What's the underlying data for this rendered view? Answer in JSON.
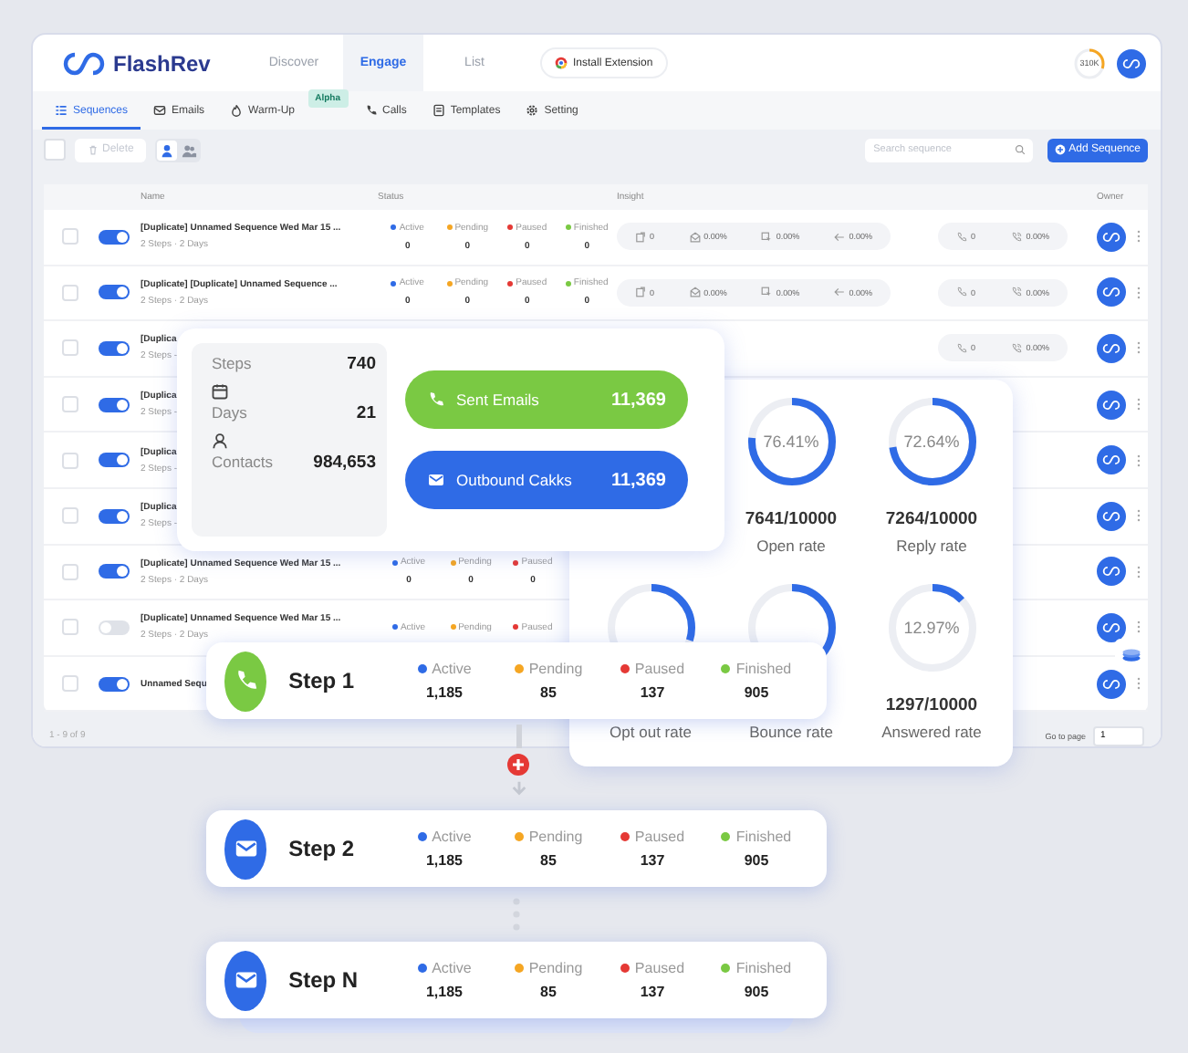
{
  "header": {
    "logo": "FlashRev",
    "tabs": [
      {
        "label": "Discover",
        "selected": false
      },
      {
        "label": "Engage",
        "selected": true
      },
      {
        "label": "List",
        "selected": false
      }
    ],
    "extension_button": "Install Extension",
    "credits": "310K"
  },
  "subnav": [
    {
      "label": "Sequences",
      "kind": "list",
      "selected": true
    },
    {
      "label": "Emails",
      "kind": "mail",
      "selected": false
    },
    {
      "label": "Warm-Up",
      "kind": "flame",
      "selected": false,
      "badge": "Alpha"
    },
    {
      "label": "Calls",
      "kind": "phone",
      "selected": false
    },
    {
      "label": "Templates",
      "kind": "template",
      "selected": false
    },
    {
      "label": "Setting",
      "kind": "gear",
      "selected": false
    }
  ],
  "toolbar": {
    "select_all_checked": false,
    "delete_button": "Delete",
    "delete_disabled": true,
    "view_toggle": [
      {
        "kind": "single",
        "selected": true
      },
      {
        "kind": "group",
        "selected": false
      }
    ],
    "search": {
      "placeholder": "Search sequence"
    },
    "add_button": "Add Sequence"
  },
  "table": {
    "columns": [
      "Name",
      "Status",
      "Insight",
      "Owner"
    ],
    "rows": [
      {
        "checked": false,
        "toggle_on": true,
        "name": "[Duplicate] Unnamed Sequence Wed Mar 15 ...",
        "meta": "2 Steps · 2 Days",
        "statuses": [
          {
            "label": "Active",
            "count": "0",
            "color": "#2f6be6"
          },
          {
            "label": "Pending",
            "count": "0",
            "color": "#f5a623"
          },
          {
            "label": "Paused",
            "count": "0",
            "color": "#e53935"
          },
          {
            "label": "Finished",
            "count": "0",
            "color": "#7ac943"
          }
        ],
        "email_insight": [
          {
            "kind": "sent",
            "value": "0"
          },
          {
            "kind": "open",
            "value": "0.00%"
          },
          {
            "kind": "click",
            "value": "0.00%"
          },
          {
            "kind": "reply",
            "value": "0.00%"
          }
        ],
        "call_insight": [
          {
            "kind": "call",
            "value": "0"
          },
          {
            "kind": "connect",
            "value": "0.00%"
          }
        ]
      },
      {
        "checked": false,
        "toggle_on": true,
        "name": "[Duplicate] [Duplicate] Unnamed Sequence ...",
        "meta": "2 Steps · 2 Days",
        "statuses": [
          {
            "label": "Active",
            "count": "0",
            "color": "#2f6be6"
          },
          {
            "label": "Pending",
            "count": "0",
            "color": "#f5a623"
          },
          {
            "label": "Paused",
            "count": "0",
            "color": "#e53935"
          },
          {
            "label": "Finished",
            "count": "0",
            "color": "#7ac943"
          }
        ],
        "email_insight": [
          {
            "kind": "sent",
            "value": "0"
          },
          {
            "kind": "open",
            "value": "0.00%"
          },
          {
            "kind": "click",
            "value": "0.00%"
          },
          {
            "kind": "reply",
            "value": "0.00%"
          }
        ],
        "call_insight": [
          {
            "kind": "call",
            "value": "0"
          },
          {
            "kind": "connect",
            "value": "0.00%"
          }
        ]
      },
      {
        "checked": false,
        "toggle_on": true,
        "name": "[Duplica",
        "meta": "2 Steps -",
        "statuses": [],
        "email_insight": [],
        "call_insight": [
          {
            "kind": "call",
            "value": "0"
          },
          {
            "kind": "connect",
            "value": "0.00%"
          }
        ]
      },
      {
        "checked": false,
        "toggle_on": true,
        "name": "[Duplica",
        "meta": "2 Steps -",
        "statuses": [],
        "email_insight": [],
        "call_insight": []
      },
      {
        "checked": false,
        "toggle_on": true,
        "name": "[Duplica",
        "meta": "2 Steps -",
        "statuses": [],
        "email_insight": [],
        "call_insight": []
      },
      {
        "checked": false,
        "toggle_on": true,
        "name": "[Duplica",
        "meta": "2 Steps -",
        "statuses": [],
        "email_insight": [],
        "call_insight": []
      },
      {
        "checked": false,
        "toggle_on": true,
        "name": "[Duplicate] Unnamed Sequence Wed Mar 15 ...",
        "meta": "2 Steps · 2 Days",
        "statuses": [
          {
            "label": "Active",
            "count": "0",
            "color": "#2f6be6"
          },
          {
            "label": "Pending",
            "count": "0",
            "color": "#f5a623"
          },
          {
            "label": "Paused",
            "count": "0",
            "color": "#e53935"
          }
        ],
        "email_insight": [],
        "call_insight": []
      },
      {
        "checked": false,
        "toggle_on": false,
        "name": "[Duplicate] Unnamed Sequence Wed Mar 15 ...",
        "meta": "2 Steps · 2 Days",
        "statuses": [
          {
            "label": "Active",
            "color": "#2f6be6"
          },
          {
            "label": "Pending",
            "color": "#f5a623"
          },
          {
            "label": "Paused",
            "color": "#e53935"
          }
        ],
        "email_insight": [],
        "call_insight": []
      },
      {
        "checked": false,
        "toggle_on": true,
        "name": "Unnamed Sequ",
        "statuses": [],
        "email_insight": [],
        "call_insight": []
      }
    ]
  },
  "pagination": {
    "summary": "1 - 9 of 9",
    "goto_label": "Go to page",
    "page": "1"
  },
  "stats_card": {
    "items": [
      {
        "kind": "steps",
        "label": "Steps",
        "value": "740"
      },
      {
        "kind": "days",
        "label": "Days",
        "value": "21"
      },
      {
        "kind": "contacts",
        "label": "Contacts",
        "value": "984,653"
      }
    ],
    "pills": [
      {
        "kind": "phone",
        "label": "Sent Emails",
        "value": "11,369",
        "color": "#7ac943"
      },
      {
        "kind": "mail",
        "label": "Outbound Cakks",
        "value": "11,369",
        "color": "#2f6be6"
      }
    ]
  },
  "rates": [
    {
      "percent": "76.41%",
      "fraction": "7641/10000",
      "label": "Open rate",
      "level": 0.7641
    },
    {
      "percent": "72.64%",
      "fraction": "7264/10000",
      "label": "Reply rate",
      "level": 0.7264
    },
    {
      "label": "Opt out rate",
      "level": 0.3
    },
    {
      "label": "Bounce rate",
      "level": 0.4
    },
    {
      "percent": "12.97%",
      "fraction": "1297/10000",
      "label": "Answered rate",
      "level": 0.1297
    }
  ],
  "steps": [
    {
      "kind": "call",
      "title": "Step 1",
      "stats": [
        {
          "label": "Active",
          "value": "1,185",
          "color": "#2f6be6"
        },
        {
          "label": "Pending",
          "value": "85",
          "color": "#f5a623"
        },
        {
          "label": "Paused",
          "value": "137",
          "color": "#e53935"
        },
        {
          "label": "Finished",
          "value": "905",
          "color": "#7ac943"
        }
      ]
    },
    {
      "kind": "email",
      "title": "Step 2",
      "stats": [
        {
          "label": "Active",
          "value": "1,185",
          "color": "#2f6be6"
        },
        {
          "label": "Pending",
          "value": "85",
          "color": "#f5a623"
        },
        {
          "label": "Paused",
          "value": "137",
          "color": "#e53935"
        },
        {
          "label": "Finished",
          "value": "905",
          "color": "#7ac943"
        }
      ]
    },
    {
      "kind": "email",
      "title": "Step N",
      "stats": [
        {
          "label": "Active",
          "value": "1,185",
          "color": "#2f6be6"
        },
        {
          "label": "Pending",
          "value": "85",
          "color": "#f5a623"
        },
        {
          "label": "Paused",
          "value": "137",
          "color": "#e53935"
        },
        {
          "label": "Finished",
          "value": "905",
          "color": "#7ac943"
        }
      ]
    }
  ]
}
